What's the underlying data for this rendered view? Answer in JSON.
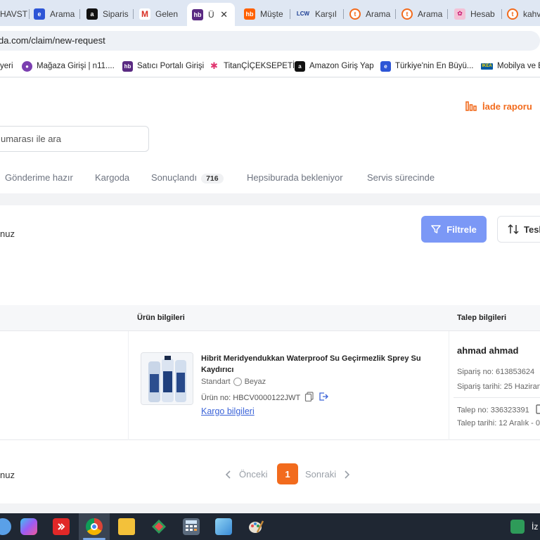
{
  "browser": {
    "tabs": [
      {
        "label": "HAVST",
        "icon": "generic"
      },
      {
        "label": "Arama",
        "icon": "search-blue"
      },
      {
        "label": "Siparis",
        "icon": "amazon"
      },
      {
        "label": "Gelen",
        "icon": "gmail"
      },
      {
        "label": "Ü",
        "icon": "hepsiburada",
        "active": true
      },
      {
        "label": "Müşte",
        "icon": "hepsiburada-orange"
      },
      {
        "label": "Karşıl",
        "icon": "lcw"
      },
      {
        "label": "Arama",
        "icon": "orange-circle"
      },
      {
        "label": "Arama",
        "icon": "orange-circle"
      },
      {
        "label": "Hesab",
        "icon": "ciceksepeti"
      },
      {
        "label": "kahve",
        "icon": "orange-circle"
      }
    ],
    "url": "da.com/claim/new-request",
    "bookmarks": [
      {
        "label": "yeri",
        "icon": "generic"
      },
      {
        "label": "Mağaza Girişi | n11....",
        "icon": "n11"
      },
      {
        "label": "Satıcı Portalı Girişi",
        "icon": "hepsiburada"
      },
      {
        "label": "TitanÇİÇEKSEPETİ",
        "icon": "ciceksepeti"
      },
      {
        "label": "Amazon Giriş Yap",
        "icon": "amazon"
      },
      {
        "label": "Türkiye'nin En Büyü...",
        "icon": "search-blue"
      },
      {
        "label": "Mobilya ve E",
        "icon": "ikea"
      }
    ]
  },
  "page": {
    "report_link": "İade raporu",
    "search_placeholder": "umarası ile ara",
    "status_tabs": [
      {
        "label": "Gönderime hazır"
      },
      {
        "label": "Kargoda"
      },
      {
        "label": "Sonuçlandı",
        "count": "716"
      },
      {
        "label": "Hepsiburada bekleniyor"
      },
      {
        "label": "Servis sürecinde"
      }
    ],
    "toolbar_hint": "nuz",
    "filter_label": "Filtrele",
    "sort_label": "Tesl",
    "table": {
      "headers": [
        "Ürün bilgileri",
        "Talep bilgileri"
      ],
      "row": {
        "product_name": "Hibrit Meridyendukkan Waterproof Su Geçirmezlik Sprey Su Kaydırıcı",
        "variant_type": "Standart",
        "variant_color": "Beyaz",
        "product_no": "Ürün no: HBCV0000122JWT",
        "shipping_link": "Kargo bilgileri",
        "customer": "ahmad ahmad",
        "order_no": "Sipariş no: 613853624",
        "order_date": "Sipariş tarihi: 25 Haziran",
        "claim_no": "Talep no: 336323391",
        "claim_date": "Talep tarihi: 12 Aralık - 0"
      }
    },
    "pager": {
      "left_text": "nuz",
      "prev": "Önceki",
      "current": "1",
      "next": "Sonraki"
    }
  },
  "taskbar": {
    "tray_text": "İz"
  },
  "colors": {
    "accent_orange": "#f26b1d",
    "filter_blue": "#7b98f6",
    "link_blue": "#3b63d8"
  }
}
